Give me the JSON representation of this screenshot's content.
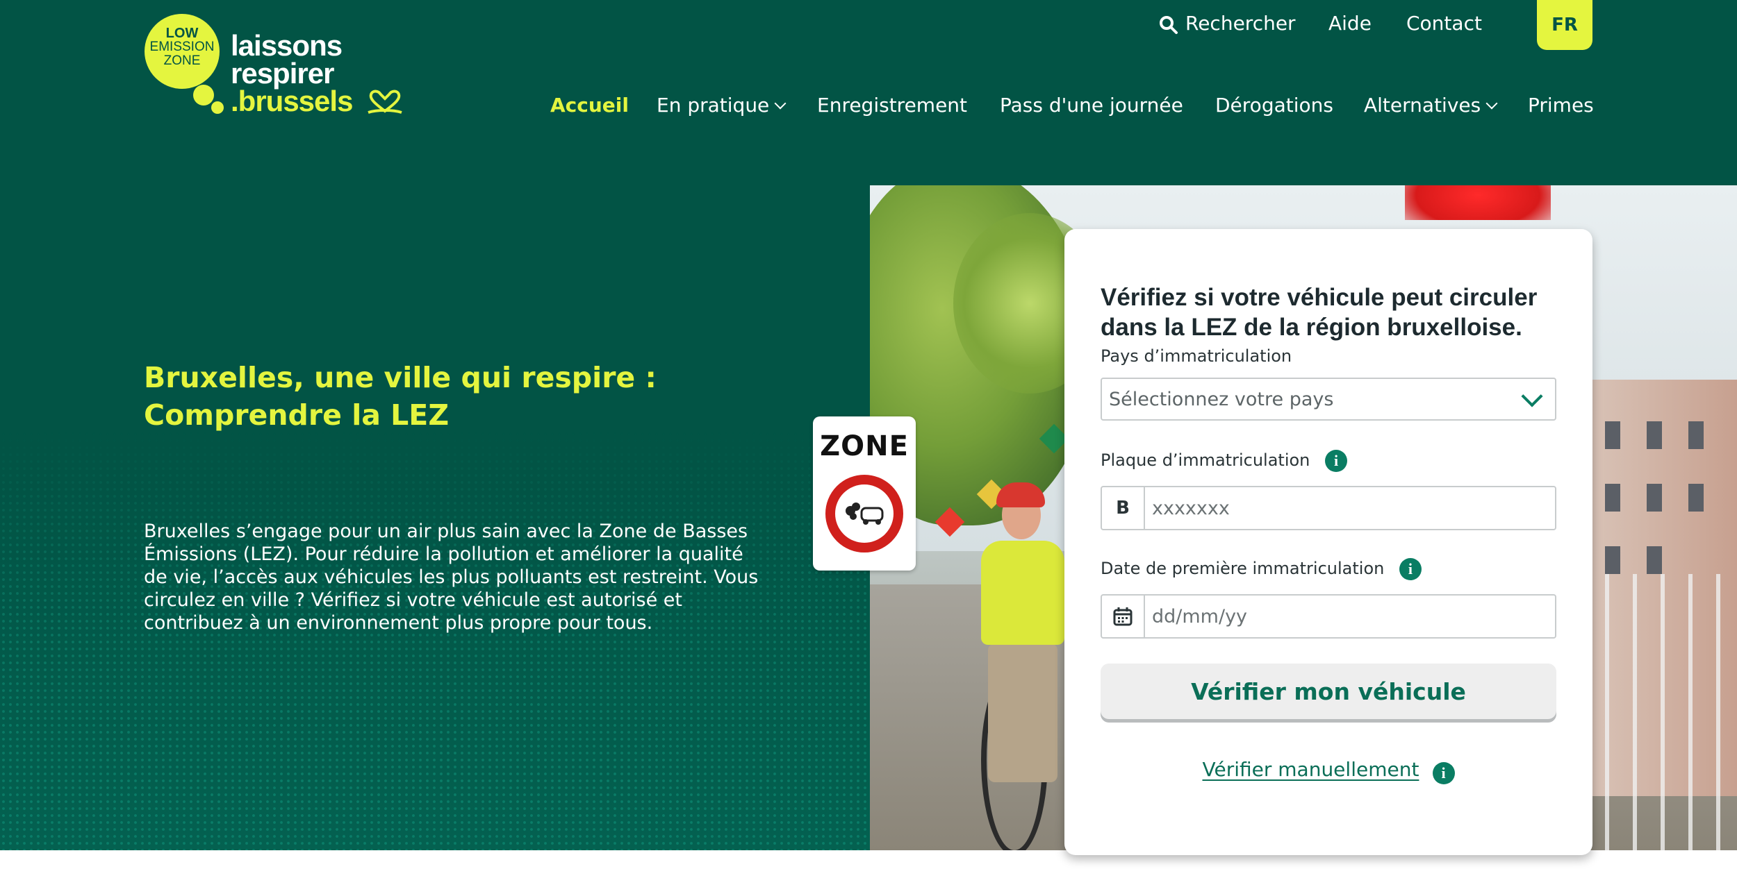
{
  "logo": {
    "badge_line1": "LOW",
    "badge_line2": "EMISSION",
    "badge_line3": "ZONE",
    "text_line1": "laissons",
    "text_line2": "respirer",
    "text_line3": ".brussels"
  },
  "topnav": {
    "search": "Rechercher",
    "help": "Aide",
    "contact": "Contact",
    "language": "FR"
  },
  "mainnav": {
    "items": [
      {
        "label": "Accueil",
        "active": true
      },
      {
        "label": "En pratique",
        "dropdown": true
      },
      {
        "label": "Enregistrement"
      },
      {
        "label": "Pass d'une journée"
      },
      {
        "label": "Dérogations"
      },
      {
        "label": "Alternatives",
        "dropdown": true
      },
      {
        "label": "Primes"
      }
    ]
  },
  "hero": {
    "title": "Bruxelles, une ville qui respire : Comprendre la LEZ",
    "description": "Bruxelles s’engage pour un air plus sain avec la Zone de Basses Émissions (LEZ). Pour réduire la pollution et améliorer la qualité de vie, l’accès aux véhicules les plus polluants est restreint. Vous circulez en ville ? Vérifiez si votre véhicule est autorisé et contribuez à un environnement plus propre pour tous."
  },
  "zone_sign": {
    "text": "ZONE"
  },
  "form": {
    "title": "Vérifiez si votre véhicule peut circuler dans la LEZ de la région bruxelloise.",
    "country_label": "Pays d’immatriculation",
    "country_placeholder": "Sélectionnez votre pays",
    "plate_label": "Plaque d’immatriculation",
    "plate_prefix": "B",
    "plate_placeholder": "xxxxxxx",
    "date_label": "Date de première immatriculation",
    "date_placeholder": "dd/mm/yy",
    "submit_label": "Vérifier mon véhicule",
    "manual_link": "Vérifier manuellement",
    "info_glyph": "i"
  },
  "colors": {
    "brand_green": "#025445",
    "accent_yellow": "#e4f53f",
    "action_green": "#0a7d63"
  }
}
